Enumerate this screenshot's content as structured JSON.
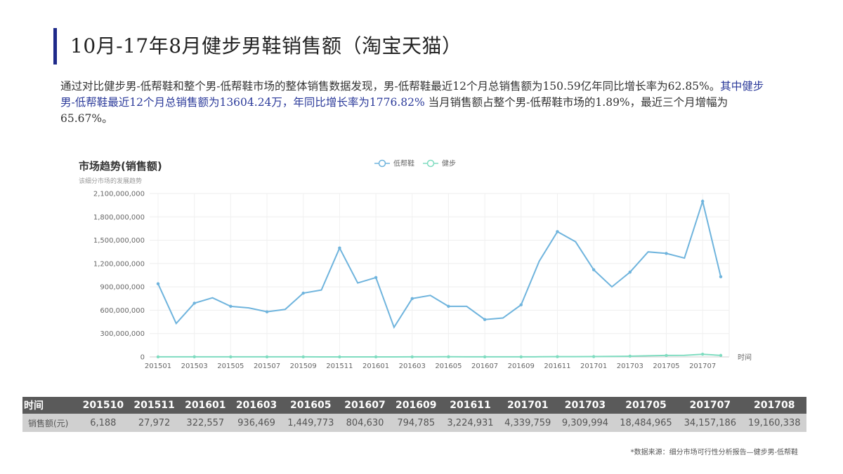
{
  "page": {
    "title": "10月-17年8月健步男鞋销售额（淘宝天猫）",
    "desc_part1": "通过对比健步男-低帮鞋和整个男-低帮鞋市场的整体销售数据发现，男-低帮鞋最近12个月总销售额为150.59亿年同比增长率为62.85%。",
    "desc_highlight": "其中健步男-低帮鞋最近12个月总销售额为13604.24万，年同比增长率为1776.82%",
    "desc_part2": " 当月销售额占整个男-低帮鞋市场的1.89%，最近三个月增幅为65.67%。",
    "source": "*数据来源：细分市场可行性分析报告—健步男-低帮鞋"
  },
  "chart_data": {
    "type": "line",
    "title": "市场趋势(销售额)",
    "subtitle": "该细分市场的发展趋势",
    "xlabel": "时间",
    "x": [
      "201501",
      "201502",
      "201503",
      "201504",
      "201505",
      "201506",
      "201507",
      "201508",
      "201509",
      "201510",
      "201511",
      "201512",
      "201601",
      "201602",
      "201603",
      "201604",
      "201605",
      "201606",
      "201607",
      "201608",
      "201609",
      "201610",
      "201611",
      "201612",
      "201701",
      "201702",
      "201703",
      "201704",
      "201705",
      "201706",
      "201707",
      "201708"
    ],
    "x_tick_labels": [
      "201501",
      "201503",
      "201505",
      "201507",
      "201509",
      "201511",
      "201601",
      "201603",
      "201605",
      "201607",
      "201609",
      "201611",
      "201701",
      "201703",
      "201705",
      "201707"
    ],
    "y_ticks": [
      "0",
      "300,000,000",
      "600,000,000",
      "900,000,000",
      "1,200,000,000",
      "1,500,000,000",
      "1,800,000,000",
      "2,100,000,000"
    ],
    "ylim": [
      0,
      2100000000
    ],
    "grid": true,
    "legend_position": "top",
    "series": [
      {
        "name": "低帮鞋",
        "color": "#6fb4dd",
        "values": [
          940000000,
          430000000,
          690000000,
          760000000,
          650000000,
          630000000,
          580000000,
          610000000,
          820000000,
          860000000,
          1400000000,
          950000000,
          1020000000,
          380000000,
          750000000,
          790000000,
          650000000,
          650000000,
          480000000,
          500000000,
          670000000,
          1230000000,
          1610000000,
          1480000000,
          1120000000,
          900000000,
          1090000000,
          1350000000,
          1330000000,
          1270000000,
          2000000000,
          1030000000
        ]
      },
      {
        "name": "健步",
        "color": "#7fdcc0",
        "values": [
          500000,
          800000,
          1200000,
          900000,
          700000,
          600000,
          500000,
          800000,
          1000000,
          6188,
          27972,
          200000,
          322557,
          300000,
          936469,
          1000000,
          1449773,
          1000000,
          804630,
          800000,
          794785,
          2000000,
          3224931,
          4000000,
          4339759,
          6000000,
          9309994,
          14000000,
          18484965,
          20000000,
          34157186,
          19160338
        ]
      }
    ]
  },
  "table": {
    "headers": [
      "时间",
      "201510",
      "201511",
      "201601",
      "201603",
      "201605",
      "201607",
      "201609",
      "201611",
      "201701",
      "201703",
      "201705",
      "201707",
      "201708"
    ],
    "rows": [
      [
        "销售额(元)",
        "6,188",
        "27,972",
        "322,557",
        "936,469",
        "1,449,773",
        "804,630",
        "794,785",
        "3,224,931",
        "4,339,759",
        "9,309,994",
        "18,484,965",
        "34,157,186",
        "19,160,338"
      ]
    ]
  }
}
